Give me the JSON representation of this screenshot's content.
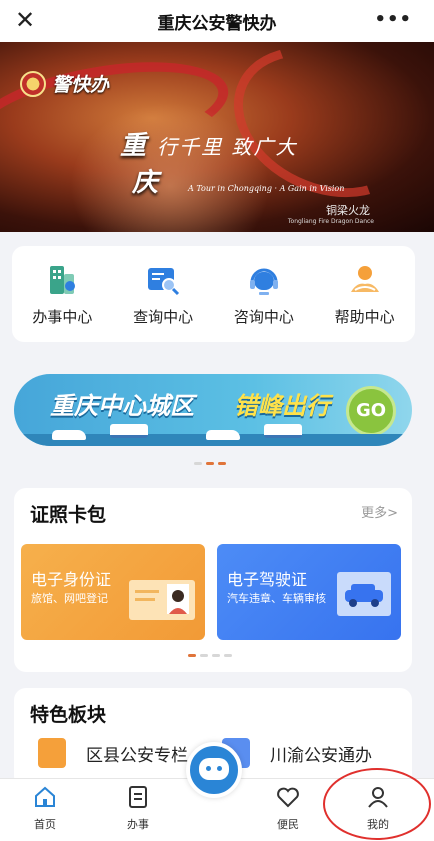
{
  "header": {
    "title": "重庆公安警快办",
    "close_glyph": "✕",
    "more_glyph": "•••"
  },
  "hero": {
    "logo_text": "警快办",
    "slogan_char1": "重",
    "slogan_char2": "庆",
    "slogan_rest": "行千里 致广大",
    "slogan_en": "A Tour in Chongqing · A Gain in Vision",
    "tag": "铜梁火龙",
    "tag_en": "Tongliang Fire Dragon Dance"
  },
  "services": [
    {
      "label": "办事中心",
      "icon": "office-building-icon",
      "color": "#3aa48a"
    },
    {
      "label": "查询中心",
      "icon": "search-document-icon",
      "color": "#2f7fe0"
    },
    {
      "label": "咨询中心",
      "icon": "headset-icon",
      "color": "#2f7fe0"
    },
    {
      "label": "帮助中心",
      "icon": "helping-hand-icon",
      "color": "#f5a03a"
    }
  ],
  "banner": {
    "text_white": "重庆中心城区",
    "text_yellow": "错峰出行",
    "go": "GO",
    "go_arrows": ">>>>"
  },
  "license_wallet": {
    "title": "证照卡包",
    "more": "更多>",
    "cards": [
      {
        "title": "电子身份证",
        "subtitle": "旅馆、网吧登记",
        "color": "#f4a742"
      },
      {
        "title": "电子驾驶证",
        "subtitle": "汽车违章、车辆审核",
        "color": "#3f7ff3"
      }
    ]
  },
  "featured": {
    "title": "特色板块",
    "items": [
      {
        "label": "区县公安专栏",
        "icon": "document-person-icon"
      },
      {
        "label": "川渝公安通办",
        "icon": "cards-icon"
      }
    ]
  },
  "tabbar": {
    "items": [
      {
        "label": "首页",
        "icon": "home-icon",
        "active": true
      },
      {
        "label": "办事",
        "icon": "document-icon",
        "active": false
      },
      {
        "label": "便民",
        "icon": "heart-icon",
        "active": false
      },
      {
        "label": "我的",
        "icon": "person-icon",
        "active": false
      }
    ]
  },
  "colors": {
    "accent": "#2a85d6",
    "annotation": "#e0302d"
  }
}
